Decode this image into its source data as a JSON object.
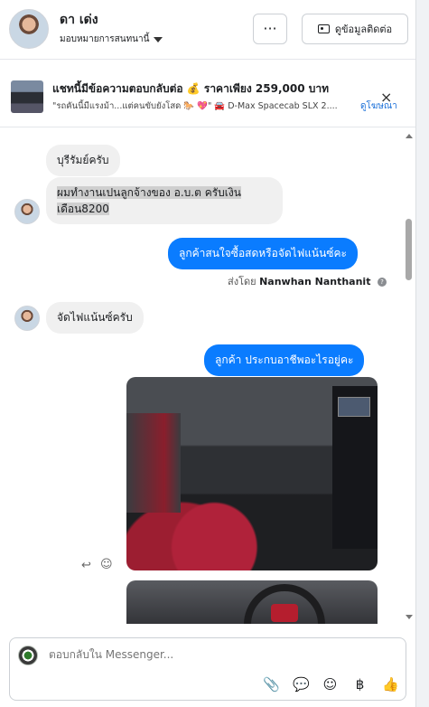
{
  "header": {
    "contact_name": "ดา เด่ง",
    "assign_label": "มอบหมายการสนทนานี้",
    "more_label": "···",
    "contact_info_label": "ดูข้อมูลติดต่อ"
  },
  "ad": {
    "title": "แชทนี้มีข้อความตอบกลับต่อ 💰 ราคาเพียง 259,000 บาท",
    "subtitle": "\"รถคันนี้มีแรงม้า...แต่คนขับยังโสด 🐎 💖\" 🚘 D-Max Spacecab SLX 2....",
    "link_label": "ดูโฆษณา",
    "close_icon": "×"
  },
  "messages": {
    "m1": "บุรีรัมย์ครับ",
    "m2_line1": "ผมทำงานเปนลูกจ้างของ อ.บ.ต ครับเงิน",
    "m2_line2": "เดือน8200",
    "m3": "ลูกค้าสนใจซื้อสดหรือจัดไฟแน้นซ์คะ",
    "sent_by_prefix": "ส่งโดย",
    "sent_by_name": "Nanwhan Nanthanit",
    "m4": "จัดไฟแน้นซ์ครับ",
    "m5": "ลูกค้า ประกบอาชีพอะไรอยู่คะ"
  },
  "composer": {
    "placeholder": "ตอบกลับใน Messenger..."
  },
  "tool_icons": {
    "attach": "📎",
    "saved_reply": "💬",
    "emoji": "☺",
    "payment": "฿",
    "like": "👍"
  },
  "colors": {
    "outgoing": "#0a7cff",
    "incoming": "#f0f0f0"
  }
}
